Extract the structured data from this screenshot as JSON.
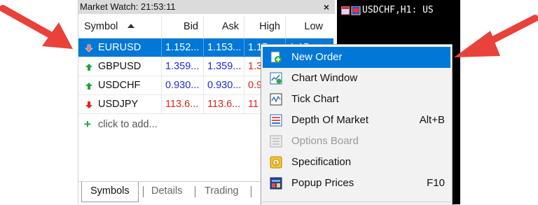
{
  "market_watch": {
    "title": "Market Watch: 21:53:11",
    "close_glyph": "×",
    "columns": {
      "symbol": "Symbol",
      "bid": "Bid",
      "ask": "Ask",
      "high": "High",
      "low": "Low"
    },
    "rows": [
      {
        "symbol": "EURUSD",
        "bid": "1.152...",
        "ask": "1.153...",
        "high": "1.15...",
        "low": "1.15...",
        "direction": "down",
        "selected": true
      },
      {
        "symbol": "GBPUSD",
        "bid": "1.359...",
        "ask": "1.359...",
        "high": "1.3",
        "low": "",
        "direction": "up"
      },
      {
        "symbol": "USDCHF",
        "bid": "0.930...",
        "ask": "0.930...",
        "high": "0.9",
        "low": "",
        "direction": "up"
      },
      {
        "symbol": "USDJPY",
        "bid": "113.6...",
        "ask": "113.6...",
        "high": "11",
        "low": "",
        "direction": "down"
      }
    ],
    "add_label": "click to add...",
    "tabs": [
      "Symbols",
      "Details",
      "Trading"
    ]
  },
  "chart": {
    "title": "USDCHF,H1: US"
  },
  "context_menu": {
    "items": [
      {
        "label": "New Order",
        "shortcut": "",
        "icon": "new-order-icon",
        "highlighted": true
      },
      {
        "label": "Chart Window",
        "shortcut": "",
        "icon": "chart-window-icon"
      },
      {
        "label": "Tick Chart",
        "shortcut": "",
        "icon": "tick-chart-icon"
      },
      {
        "label": "Depth Of Market",
        "shortcut": "Alt+B",
        "icon": "depth-of-market-icon"
      },
      {
        "label": "Options Board",
        "shortcut": "",
        "icon": "options-board-icon",
        "disabled": true
      },
      {
        "label": "Specification",
        "shortcut": "",
        "icon": "specification-icon"
      },
      {
        "label": "Popup Prices",
        "shortcut": "F10",
        "icon": "popup-prices-icon"
      }
    ]
  },
  "colors": {
    "selection": "#0078d7",
    "bid_up": "#1f2bd6",
    "bid_down": "#e2231a",
    "arrow_annotation": "#e8423a"
  }
}
